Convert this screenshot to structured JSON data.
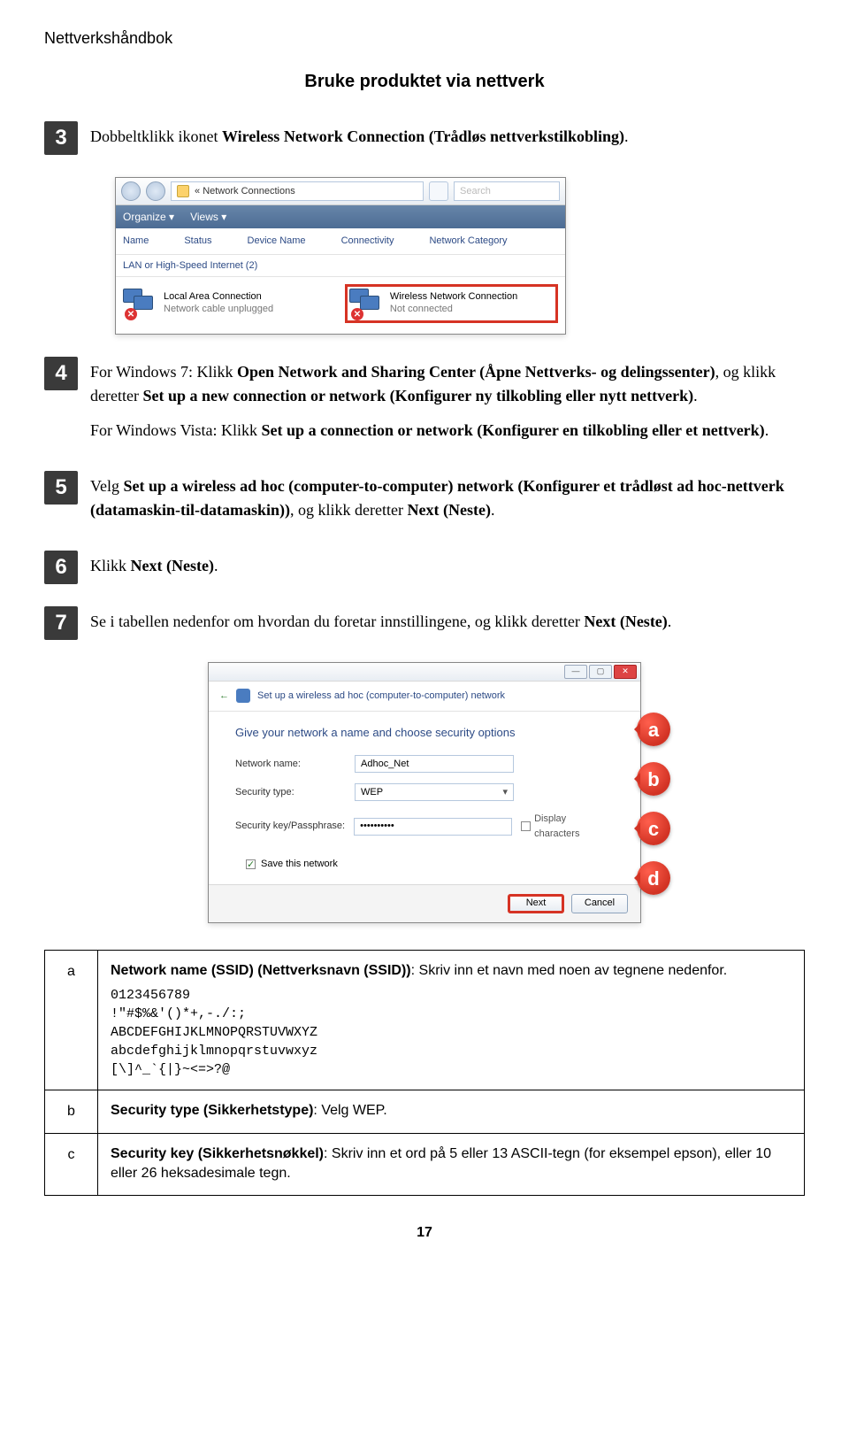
{
  "header": {
    "title": "Nettverkshåndbok",
    "subtitle": "Bruke produktet via nettverk"
  },
  "steps": {
    "s3": {
      "num": "3",
      "pre": "Dobbeltklikk ikonet ",
      "b1": "Wireless Network Connection (Trådløs nettverkstilkobling)",
      "post": "."
    },
    "s4": {
      "num": "4",
      "p1_pre": "For Windows 7: Klikk ",
      "p1_b1": "Open Network and Sharing Center (Åpne Nettverks- og delingssenter)",
      "p1_mid": ", og klikk deretter ",
      "p1_b2": "Set up a new connection or network (Konfigurer ny tilkobling eller nytt nettverk)",
      "p1_post": ".",
      "p2_pre": "For Windows Vista: Klikk ",
      "p2_b1": "Set up a connection or network (Konfigurer en tilkobling eller et nettverk)",
      "p2_post": "."
    },
    "s5": {
      "num": "5",
      "pre": "Velg ",
      "b1": "Set up a wireless ad hoc (computer-to-computer) network (Konfigurer et trådløst ad hoc-nettverk (datamaskin-til-datamaskin))",
      "mid": ", og klikk deretter ",
      "b2": "Next (Neste)",
      "post": "."
    },
    "s6": {
      "num": "6",
      "pre": "Klikk ",
      "b1": "Next (Neste)",
      "post": "."
    },
    "s7": {
      "num": "7",
      "pre": "Se i tabellen nedenfor om hvordan du foretar innstillingene, og klikk deretter ",
      "b1": "Next (Neste)",
      "post": "."
    }
  },
  "win1": {
    "addr": "Network Connections",
    "search": "Search",
    "organize": "Organize",
    "views": "Views",
    "col1": "Name",
    "col2": "Status",
    "col3": "Device Name",
    "col4": "Connectivity",
    "col5": "Network Category",
    "group": "LAN or High-Speed Internet (2)",
    "lac_title": "Local Area Connection",
    "lac_status": "Network cable unplugged",
    "wnc_title": "Wireless Network Connection",
    "wnc_status": "Not connected"
  },
  "wiz": {
    "title": "Set up a wireless ad hoc (computer-to-computer) network",
    "heading": "Give your network a name and choose security options",
    "lbl_name": "Network name:",
    "val_name": "Adhoc_Net",
    "lbl_sec": "Security type:",
    "val_sec": "WEP",
    "lbl_key": "Security key/Passphrase:",
    "val_key": "••••••••••",
    "disp": "Display characters",
    "save": "Save this network",
    "btn_next": "Next",
    "btn_cancel": "Cancel",
    "balloons": {
      "a": "a",
      "b": "b",
      "c": "c",
      "d": "d"
    }
  },
  "deftable": {
    "a": {
      "key": "a",
      "head": "Network name (SSID) (Nettverksnavn (SSID))",
      "tail": ": Skriv inn et navn med noen av tegnene nedenfor.",
      "mono": "0123456789\n!\"#$%&'()*+,-./:;\nABCDEFGHIJKLMNOPQRSTUVWXYZ\nabcdefghijklmnopqrstuvwxyz\n[\\]^_`{|}~<=>?@"
    },
    "b": {
      "key": "b",
      "head": "Security type (Sikkerhetstype)",
      "tail": ": Velg WEP."
    },
    "c": {
      "key": "c",
      "head": "Security key (Sikkerhetsnøkkel)",
      "tail": ": Skriv inn et ord på 5 eller 13 ASCII-tegn (for eksempel epson), eller 10 eller 26 heksadesimale tegn."
    }
  },
  "pagenum": "17"
}
